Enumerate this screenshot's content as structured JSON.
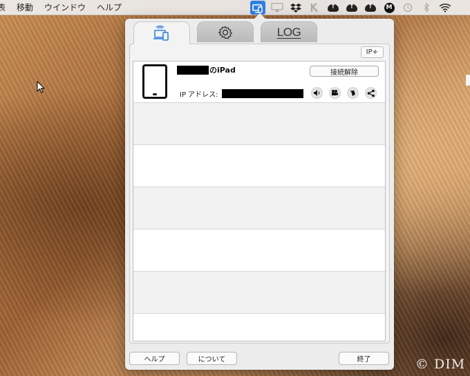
{
  "menubar": {
    "items": [
      "表",
      "移動",
      "ウインドウ",
      "ヘルプ"
    ],
    "status_icons": [
      "airserver-icon",
      "airplay-icon",
      "dropbox-icon",
      "k-icon",
      "cloud-upload-icon",
      "cloud-upload-icon",
      "cloud-upload-icon",
      "m-icon",
      "time-machine-icon",
      "bluetooth-icon",
      "wifi-icon"
    ]
  },
  "popover": {
    "tabs": [
      {
        "name": "devices-icon"
      },
      {
        "name": "gear-icon"
      },
      {
        "label": "LOG"
      }
    ],
    "ip_add_button": "IP+",
    "device": {
      "name_suffix": "のiPad",
      "disconnect_label": "接続解除",
      "ip_label": "IP アドレス:",
      "actions": [
        "speaker-icon",
        "camera-icon",
        "mouse-icon",
        "share-icon"
      ]
    },
    "footer": {
      "help_label": "ヘルプ",
      "about_label": "について",
      "quit_label": "終了"
    }
  },
  "watermark": "© DIM",
  "colors": {
    "accent": "#2f7fe0"
  }
}
